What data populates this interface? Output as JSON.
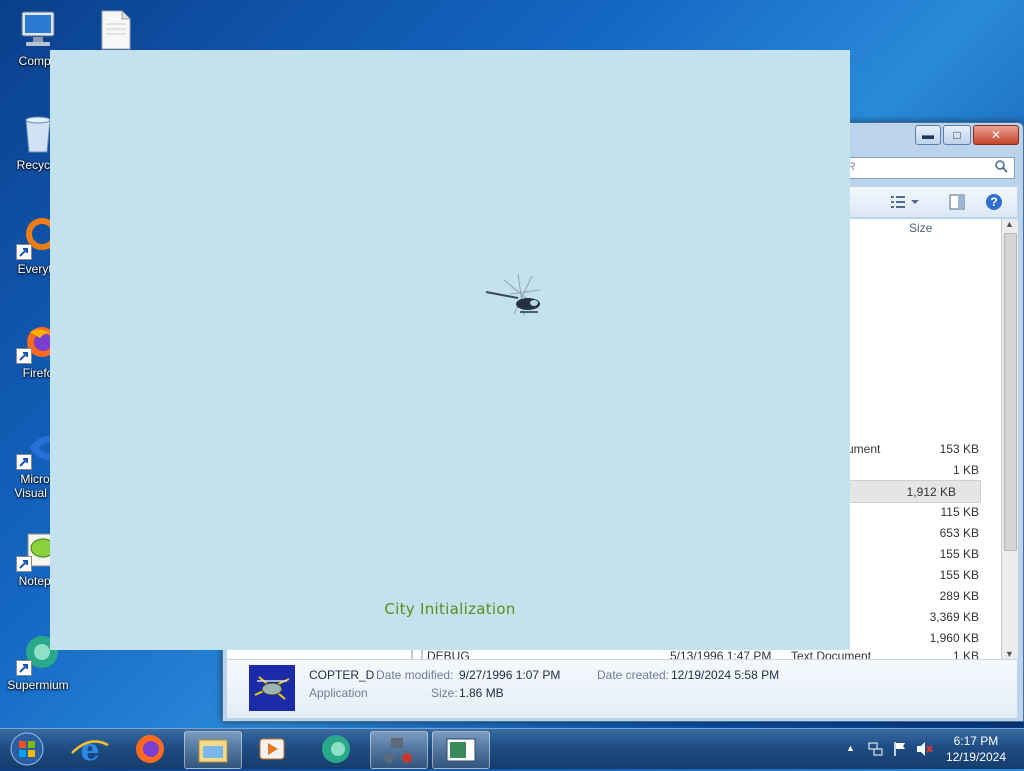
{
  "desktop": {
    "icons": [
      {
        "label": "Compu",
        "icon": "computer-icon"
      },
      {
        "label": "",
        "icon": "blank-document-icon"
      },
      {
        "label": "Recycle",
        "icon": "recycle-bin-icon"
      },
      {
        "label": "Everyth",
        "icon": "everything-search-icon"
      },
      {
        "label": "Firefo",
        "icon": "firefox-icon"
      },
      {
        "label": "Micros",
        "label2": "Visual St",
        "icon": "visual-studio-icon"
      },
      {
        "label": "Notepa",
        "icon": "notepad-plus-plus-icon"
      },
      {
        "label": "Supermium",
        "icon": "supermium-icon"
      }
    ]
  },
  "explorer": {
    "controls": {
      "minimize": "▬",
      "maximize": "□",
      "close": "✕"
    },
    "search_placeholder": "ER",
    "column_size": "Size",
    "rows": [
      {
        "type": "ument",
        "size": "153 KB"
      },
      {
        "type": "",
        "size": "1 KB"
      },
      {
        "type": "",
        "size": "1,912 KB",
        "selected": true
      },
      {
        "type": "",
        "size": "115 KB"
      },
      {
        "type": "",
        "size": "653 KB"
      },
      {
        "type": "",
        "size": "155 KB"
      },
      {
        "type": "",
        "size": "155 KB"
      },
      {
        "type": "",
        "size": "289 KB"
      },
      {
        "type": "",
        "size": "3,369 KB"
      },
      {
        "type": "",
        "size": "1,960 KB"
      },
      {
        "name": "DEBUG",
        "date": "5/13/1996 1:47 PM",
        "type": "Text Document",
        "size": "1 KB"
      }
    ],
    "details": {
      "name": "COPTER_D",
      "kind": "Application",
      "date_modified_label": "Date modified:",
      "date_modified": "9/27/1996 1:07 PM",
      "size_label": "Size:",
      "size": "1.86 MB",
      "date_created_label": "Date created:",
      "date_created": "12/19/2024 5:58 PM"
    }
  },
  "game": {
    "status_text": "City Initialization"
  },
  "taskbar": {
    "items": [
      "start-orb-icon",
      "internet-explorer-icon",
      "firefox-icon",
      "file-explorer-icon",
      "media-player-icon",
      "supermium-icon",
      "network-app-icon",
      "game-window-icon"
    ],
    "clock_time": "6:17 PM",
    "clock_date": "12/19/2024",
    "tray_arrow": "▲"
  },
  "colors": {
    "game_bg": "#c4e1ee",
    "status_text": "#5f8a1a"
  }
}
